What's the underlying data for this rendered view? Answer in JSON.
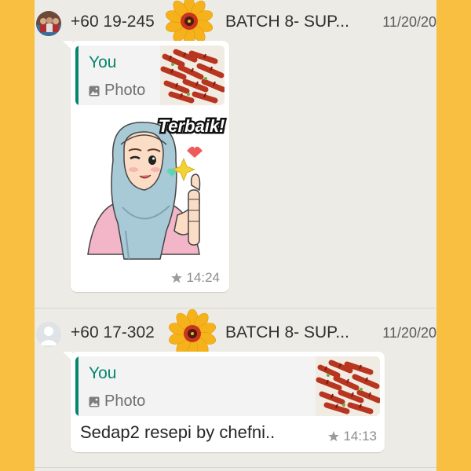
{
  "messages": [
    {
      "sender": "+60 19-245",
      "group": "BATCH 8- SUP...",
      "date": "11/20/20",
      "quoted_author": "You",
      "quoted_type": "Photo",
      "sticker_text": "Terbaik!",
      "time": "14:24"
    },
    {
      "sender": "+60 17-302",
      "group": "BATCH 8- SUP...",
      "date": "11/20/20",
      "quoted_author": "You",
      "quoted_type": "Photo",
      "caption": "Sedap2 resepi by chefni..",
      "time": "14:13"
    }
  ],
  "icons": {
    "avatar1": "group-photo-avatar",
    "avatar2": "default-user-avatar",
    "star": "star-icon",
    "photo": "photo-icon",
    "flower": "flower-sticker"
  },
  "colors": {
    "frame": "#f8bf40",
    "chat_bg": "#ecebe6",
    "quote_accent": "#07866e"
  }
}
